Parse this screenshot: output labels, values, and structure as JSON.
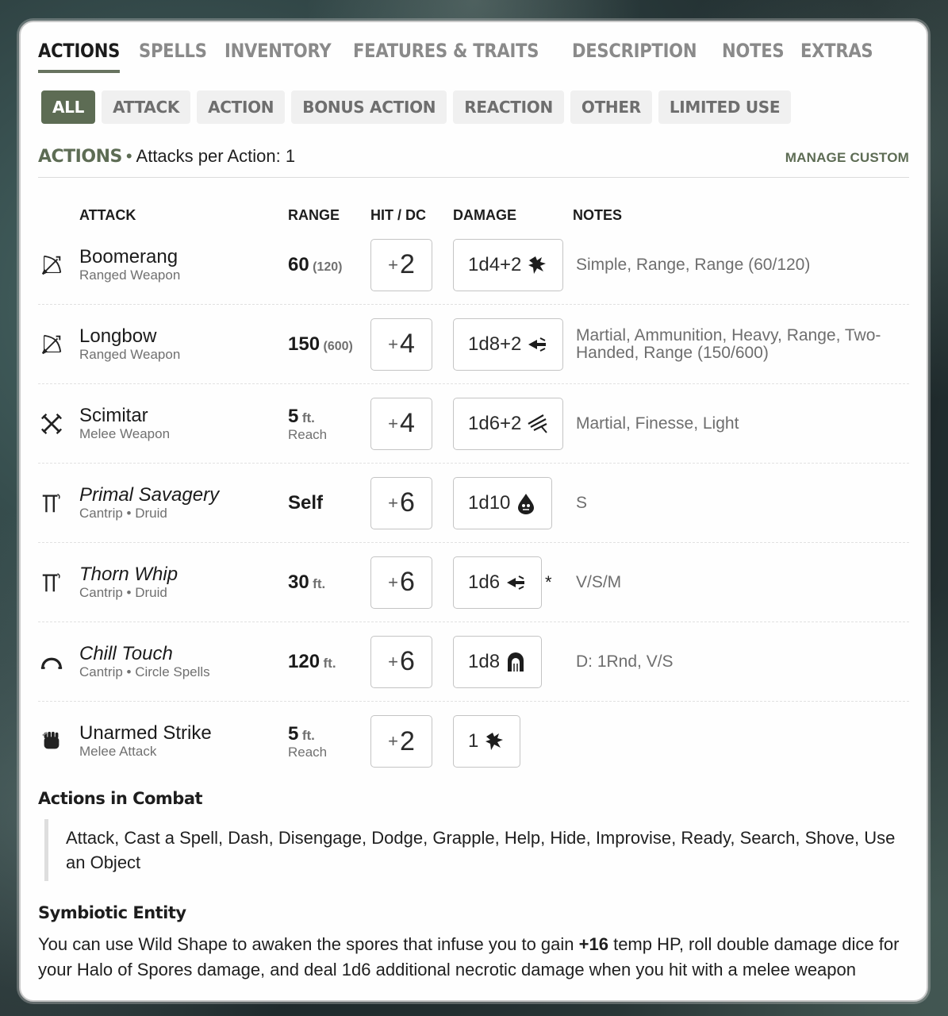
{
  "main_tabs": [
    "ACTIONS",
    "SPELLS",
    "INVENTORY",
    "FEATURES & TRAITS",
    "DESCRIPTION",
    "NOTES",
    "EXTRAS"
  ],
  "sub_tabs": [
    "ALL",
    "ATTACK",
    "ACTION",
    "BONUS ACTION",
    "REACTION",
    "OTHER",
    "LIMITED USE"
  ],
  "section": {
    "title": "ACTIONS",
    "subtitle": "Attacks per Action: 1",
    "manage_custom": "MANAGE CUSTOM"
  },
  "columns": {
    "attack": "ATTACK",
    "range": "RANGE",
    "hit": "HIT / DC",
    "damage": "DAMAGE",
    "notes": "NOTES"
  },
  "attacks": [
    {
      "icon": "ranged-weapon-icon",
      "name": "Boomerang",
      "sub": "Ranged Weapon",
      "range": "60",
      "range_long": "(120)",
      "range_unit": "",
      "reach": "",
      "hit_sign": "+",
      "hit": "2",
      "damage": "1d4+2",
      "damage_icon": "bludgeoning-icon",
      "asterisk": "",
      "notes": "Simple, Range, Range (60/120)"
    },
    {
      "icon": "ranged-weapon-icon",
      "name": "Longbow",
      "sub": "Ranged Weapon",
      "range": "150",
      "range_long": "(600)",
      "range_unit": "",
      "reach": "",
      "hit_sign": "+",
      "hit": "4",
      "damage": "1d8+2",
      "damage_icon": "piercing-icon",
      "asterisk": "",
      "notes": "Martial, Ammunition, Heavy, Range, Two-Handed, Range (150/600)"
    },
    {
      "icon": "melee-weapon-icon",
      "name": "Scimitar",
      "sub": "Melee Weapon",
      "range": "5",
      "range_long": "",
      "range_unit": "ft.",
      "reach": "Reach",
      "hit_sign": "+",
      "hit": "4",
      "damage": "1d6+2",
      "damage_icon": "slashing-icon",
      "asterisk": "",
      "notes": "Martial, Finesse, Light"
    },
    {
      "icon": "spell-icon",
      "name": "Primal Savagery",
      "sub": "Cantrip • Druid",
      "range": "Self",
      "range_long": "",
      "range_unit": "",
      "reach": "",
      "hit_sign": "+",
      "hit": "6",
      "damage": "1d10",
      "damage_icon": "acid-icon",
      "asterisk": "",
      "notes": "S"
    },
    {
      "icon": "spell-icon",
      "name": "Thorn Whip",
      "sub": "Cantrip • Druid",
      "range": "30",
      "range_long": "",
      "range_unit": "ft.",
      "reach": "",
      "hit_sign": "+",
      "hit": "6",
      "damage": "1d6",
      "damage_icon": "piercing-icon",
      "asterisk": "*",
      "notes": "V/S/M"
    },
    {
      "icon": "circle-spell-icon",
      "name": "Chill Touch",
      "sub": "Cantrip • Circle Spells",
      "range": "120",
      "range_long": "",
      "range_unit": "ft.",
      "reach": "",
      "hit_sign": "+",
      "hit": "6",
      "damage": "1d8",
      "damage_icon": "necrotic-icon",
      "asterisk": "",
      "notes": "D: 1Rnd, V/S"
    },
    {
      "icon": "unarmed-icon",
      "name": "Unarmed Strike",
      "sub": "Melee Attack",
      "range": "5",
      "range_long": "",
      "range_unit": "ft.",
      "reach": "Reach",
      "hit_sign": "+",
      "hit": "2",
      "damage": "1",
      "damage_icon": "bludgeoning-icon",
      "asterisk": "",
      "notes": ""
    }
  ],
  "combat": {
    "heading": "Actions in Combat",
    "items": [
      "Attack",
      "Cast a Spell",
      "Dash",
      "Disengage",
      "Dodge",
      "Grapple",
      "Help",
      "Hide",
      "Improvise",
      "Ready",
      "Search",
      "Shove",
      "Use an Object"
    ]
  },
  "symbiotic": {
    "heading": "Symbiotic Entity",
    "text_before": "You can use Wild Shape to awaken the spores that infuse you to gain ",
    "bold": "+16",
    "text_after": " temp HP, roll double damage dice for your Halo of Spores damage, and deal 1d6 additional necrotic damage when you hit with a melee weapon"
  }
}
